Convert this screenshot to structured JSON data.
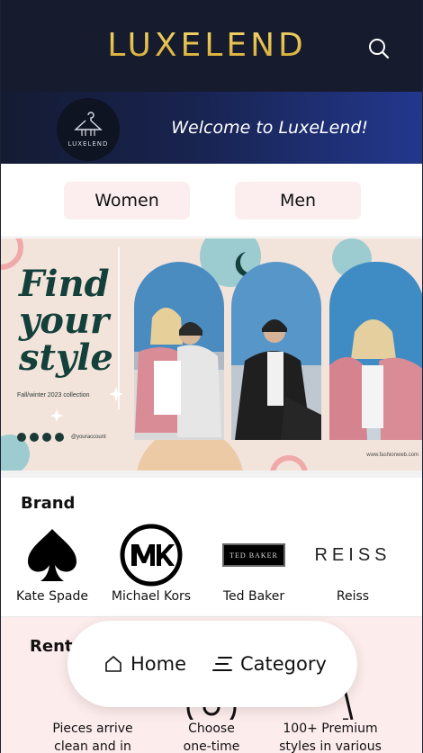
{
  "header": {
    "brand": "LUXELEND",
    "search_icon": "search-icon",
    "welcome_text": "Welcome to LuxeLend!",
    "badge_text": "LUXELEND"
  },
  "tabs": [
    {
      "label": "Women"
    },
    {
      "label": "Men"
    }
  ],
  "banner": {
    "headline_1": "Find",
    "headline_2": "your",
    "headline_3": "style",
    "subtitle": "Fall/winter 2023 collection",
    "handle": "@youraccount",
    "url": "www.fashionweb.com"
  },
  "brands": {
    "title": "Brand",
    "items": [
      {
        "name": "Kate Spade",
        "icon": "spade-icon"
      },
      {
        "name": "Michael Kors",
        "icon": "mk-logo"
      },
      {
        "name": "Ted Baker",
        "icon": "ted-baker-logo",
        "logo_text": "TED BAKER"
      },
      {
        "name": "Reiss",
        "icon": "reiss-logo",
        "logo_text": "REISS"
      }
    ]
  },
  "rent": {
    "title": "Rent",
    "items": [
      {
        "text_1": "Pieces arrive",
        "text_2": "clean and in",
        "icon": "delivery-icon"
      },
      {
        "text_1": "Choose",
        "text_2": "one-time",
        "icon": "clock-icon"
      },
      {
        "text_1": "100+ Premium",
        "text_2": "styles in various",
        "icon": "hanger-icon"
      }
    ]
  },
  "nav": {
    "home_label": "Home",
    "category_label": "Category"
  },
  "colors": {
    "header_bg": "#161b2e",
    "gold": "#e8c24b",
    "tab_bg": "#fceeee",
    "banner_green": "#14403b",
    "rent_bg": "#fdecec"
  }
}
